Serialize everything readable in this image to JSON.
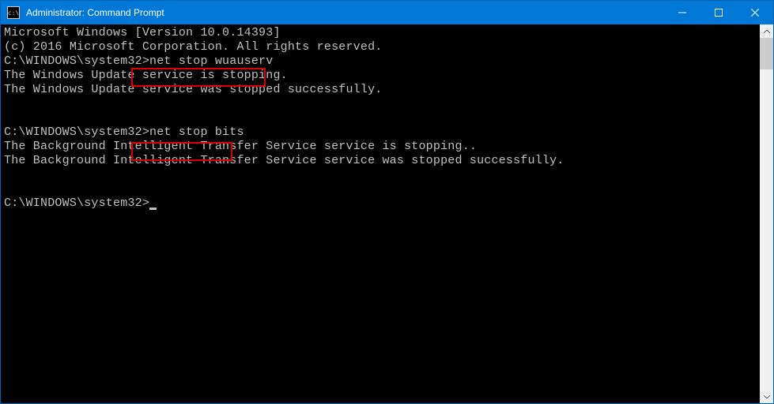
{
  "titlebar": {
    "icon_text": "c:\\",
    "title": "Administrator: Command Prompt"
  },
  "terminal": {
    "line1": "Microsoft Windows [Version 10.0.14393]",
    "line2": "(c) 2016 Microsoft Corporation. All rights reserved.",
    "blank1": "",
    "prompt1_path": "C:\\WINDOWS\\system32>",
    "prompt1_cmd": "net stop wuauserv",
    "out1a": "The Windows Update service is stopping.",
    "out1b": "The Windows Update service was stopped successfully.",
    "blank2": "",
    "blank3": "",
    "prompt2_path": "C:\\WINDOWS\\system32>",
    "prompt2_cmd": "net stop bits",
    "out2a": "The Background Intelligent Transfer Service service is stopping..",
    "out2b": "The Background Intelligent Transfer Service service was stopped successfully.",
    "blank4": "",
    "blank5": "",
    "prompt3_path": "C:\\WINDOWS\\system32>"
  },
  "highlights": {
    "cmd1": "net stop wuauserv",
    "cmd2": "net stop bits"
  }
}
